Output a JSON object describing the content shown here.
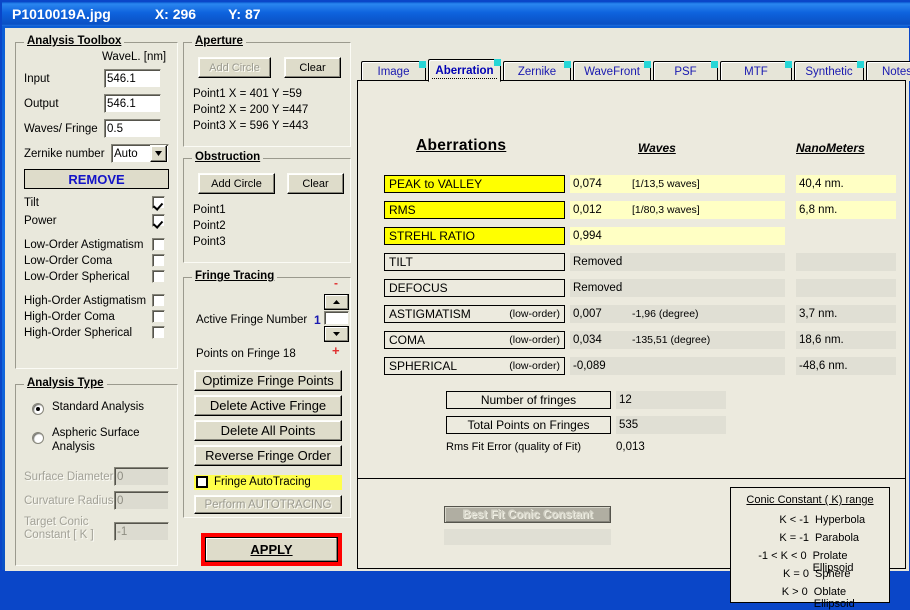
{
  "titlebar": {
    "filename": "P1010019A.jpg",
    "x_label": "X: 296",
    "y_label": "Y: 87"
  },
  "analysis_toolbox": {
    "title": "Analysis Toolbox",
    "wavelength_header": "WaveL. [nm]",
    "input_label": "Input",
    "input_value": "546.1",
    "output_label": "Output",
    "output_value": "546.1",
    "waves_fringe_label": "Waves/ Fringe",
    "waves_fringe_value": "0.5",
    "zernike_label": "Zernike number",
    "zernike_value": "Auto",
    "remove_button": "REMOVE",
    "checkboxes": [
      {
        "label": "Tilt",
        "checked": true
      },
      {
        "label": "Power",
        "checked": true
      },
      {
        "label": "Low-Order  Astigmatism",
        "checked": false
      },
      {
        "label": "Low-Order  Coma",
        "checked": false
      },
      {
        "label": "Low-Order  Spherical",
        "checked": false
      },
      {
        "label": "High-Order  Astigmatism",
        "checked": false
      },
      {
        "label": "High-Order  Coma",
        "checked": false
      },
      {
        "label": "High-Order  Spherical",
        "checked": false
      }
    ]
  },
  "analysis_type": {
    "title": "Analysis Type",
    "option_standard": "Standard  Analysis",
    "option_aspheric": "Aspheric  Surface Analysis",
    "selected": "standard",
    "surface_diameter_label": "Surface Diameter",
    "surface_diameter_value": "0",
    "curvature_radius_label": "Curvature Radius",
    "curvature_radius_value": "0",
    "target_conic_label": "Target Conic Constant [ K ]",
    "target_conic_value": "-1"
  },
  "aperture": {
    "title": "Aperture",
    "add_circle": "Add Circle",
    "clear": "Clear",
    "points": [
      "Point1  X =   401   Y =59",
      "Point2  X =   200   Y =447",
      "Point3  X =   596   Y =443"
    ]
  },
  "obstruction": {
    "title": "Obstruction",
    "add_circle": "Add Circle",
    "clear": "Clear",
    "points": [
      "Point1",
      "Point2",
      "Point3"
    ]
  },
  "fringe_tracing": {
    "title": "Fringe Tracing",
    "active_fringe_label": "Active Fringe Number",
    "active_fringe_number": "1",
    "active_fringe_input": "",
    "points_on_fringe": "Points on  Fringe 18",
    "minus_icon": "-",
    "plus_icon": "+",
    "buttons": [
      "Optimize Fringe Points",
      "Delete Active Fringe",
      "Delete  All  Points",
      "Reverse  Fringe Order"
    ],
    "autotracing_label": "Fringe AutoTracing",
    "autotracing_checked": false,
    "perform_autotracing": "Perform  AUTOTRACING"
  },
  "apply_button": "APPLY",
  "tabs": [
    {
      "label": "Image",
      "selected": false
    },
    {
      "label": "Aberration",
      "selected": true
    },
    {
      "label": "Zernike",
      "selected": false
    },
    {
      "label": "WaveFront",
      "selected": false
    },
    {
      "label": "PSF",
      "selected": false
    },
    {
      "label": "MTF",
      "selected": false
    },
    {
      "label": "Synthetic",
      "selected": false
    },
    {
      "label": "Notes",
      "selected": false
    }
  ],
  "aberrations": {
    "title": "Aberrations ",
    "col_waves": "Waves",
    "col_nanometers": "NanoMeters",
    "rows": [
      {
        "name": "PEAK to VALLEY",
        "sub": "",
        "highlight": true,
        "value": "0,074",
        "value2": "[1/13,5 waves]",
        "nm": "40,4  nm.",
        "nm_shown": true
      },
      {
        "name": "RMS",
        "sub": "",
        "highlight": true,
        "value": "0,012",
        "value2": "[1/80,3 waves]",
        "nm": "6,8  nm.",
        "nm_shown": true
      },
      {
        "name": "STREHL  RATIO",
        "sub": "",
        "highlight": true,
        "value": "0,994",
        "value2": "",
        "nm": "",
        "nm_shown": false
      },
      {
        "name": "TILT",
        "sub": "",
        "highlight": false,
        "value": "Removed",
        "value2": "",
        "nm": "",
        "nm_shown": true
      },
      {
        "name": "DEFOCUS",
        "sub": "",
        "highlight": false,
        "value": "Removed",
        "value2": "",
        "nm": "",
        "nm_shown": true
      },
      {
        "name": "ASTIGMATISM",
        "sub": "(low-order)",
        "highlight": false,
        "value": "0,007",
        "value2": "-1,96  (degree)",
        "nm": "3,7  nm.",
        "nm_shown": true
      },
      {
        "name": "COMA",
        "sub": "(low-order)",
        "highlight": false,
        "value": "0,034",
        "value2": "-135,51  (degree)",
        "nm": "18,6  nm.",
        "nm_shown": true
      },
      {
        "name": "SPHERICAL",
        "sub": "(low-order)",
        "highlight": false,
        "value": "-0,089",
        "value2": "",
        "nm": "-48,6  nm.",
        "nm_shown": true
      }
    ],
    "summary": [
      {
        "label": "Number of fringes",
        "value": "12"
      },
      {
        "label": "Total  Points on Fringes",
        "value": "535"
      }
    ],
    "rms_fit_label": "Rms Fit Error (quality of Fit)",
    "rms_fit_value": "0,013"
  },
  "best_fit": {
    "button_label": "Best Fit Conic Constant",
    "value": ""
  },
  "conic_range": {
    "title": "Conic Constant ( K)  range",
    "rows": [
      {
        "k": "K < -1",
        "desc": "Hyperbola"
      },
      {
        "k": "K = -1",
        "desc": "Parabola"
      },
      {
        "k": "-1 < K < 0",
        "desc": "Prolate Ellipsoid"
      },
      {
        "k": "K =  0",
        "desc": "Sphere"
      },
      {
        "k": "K > 0",
        "desc": "Oblate Ellipsoid"
      }
    ]
  }
}
